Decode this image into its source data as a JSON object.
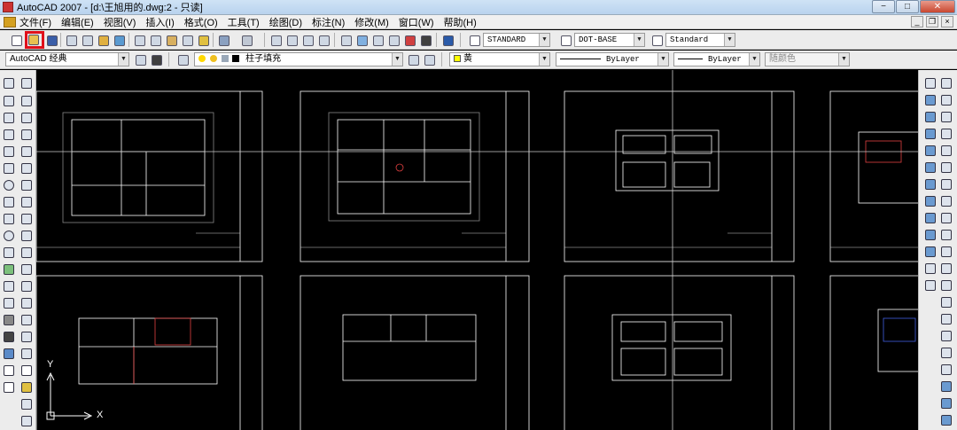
{
  "window": {
    "title": "AutoCAD 2007 - [d:\\王旭用的.dwg:2 - 只读]",
    "buttons": {
      "minimize": "−",
      "maximize": "□",
      "close": "✕"
    }
  },
  "menubar": {
    "items": [
      "文件(F)",
      "编辑(E)",
      "视图(V)",
      "插入(I)",
      "格式(O)",
      "工具(T)",
      "绘图(D)",
      "标注(N)",
      "修改(M)",
      "窗口(W)",
      "帮助(H)"
    ],
    "mdi": {
      "minimize": "_",
      "restore": "❐",
      "close": "×"
    }
  },
  "styles_toolbar": {
    "text_style": "STANDARD",
    "dim_style": "DOT-BASE",
    "table_style": "Standard"
  },
  "layers_toolbar": {
    "workspace": "AutoCAD 经典",
    "current_layer": "柱子填充",
    "color": "黄",
    "linetype": "ByLayer",
    "lineweight": "ByLayer",
    "plot_style": "随颜色"
  },
  "ucs": {
    "x_label": "X",
    "y_label": "Y"
  },
  "colors": {
    "accent_highlight": "#e0101a",
    "canvas": "#000000"
  }
}
